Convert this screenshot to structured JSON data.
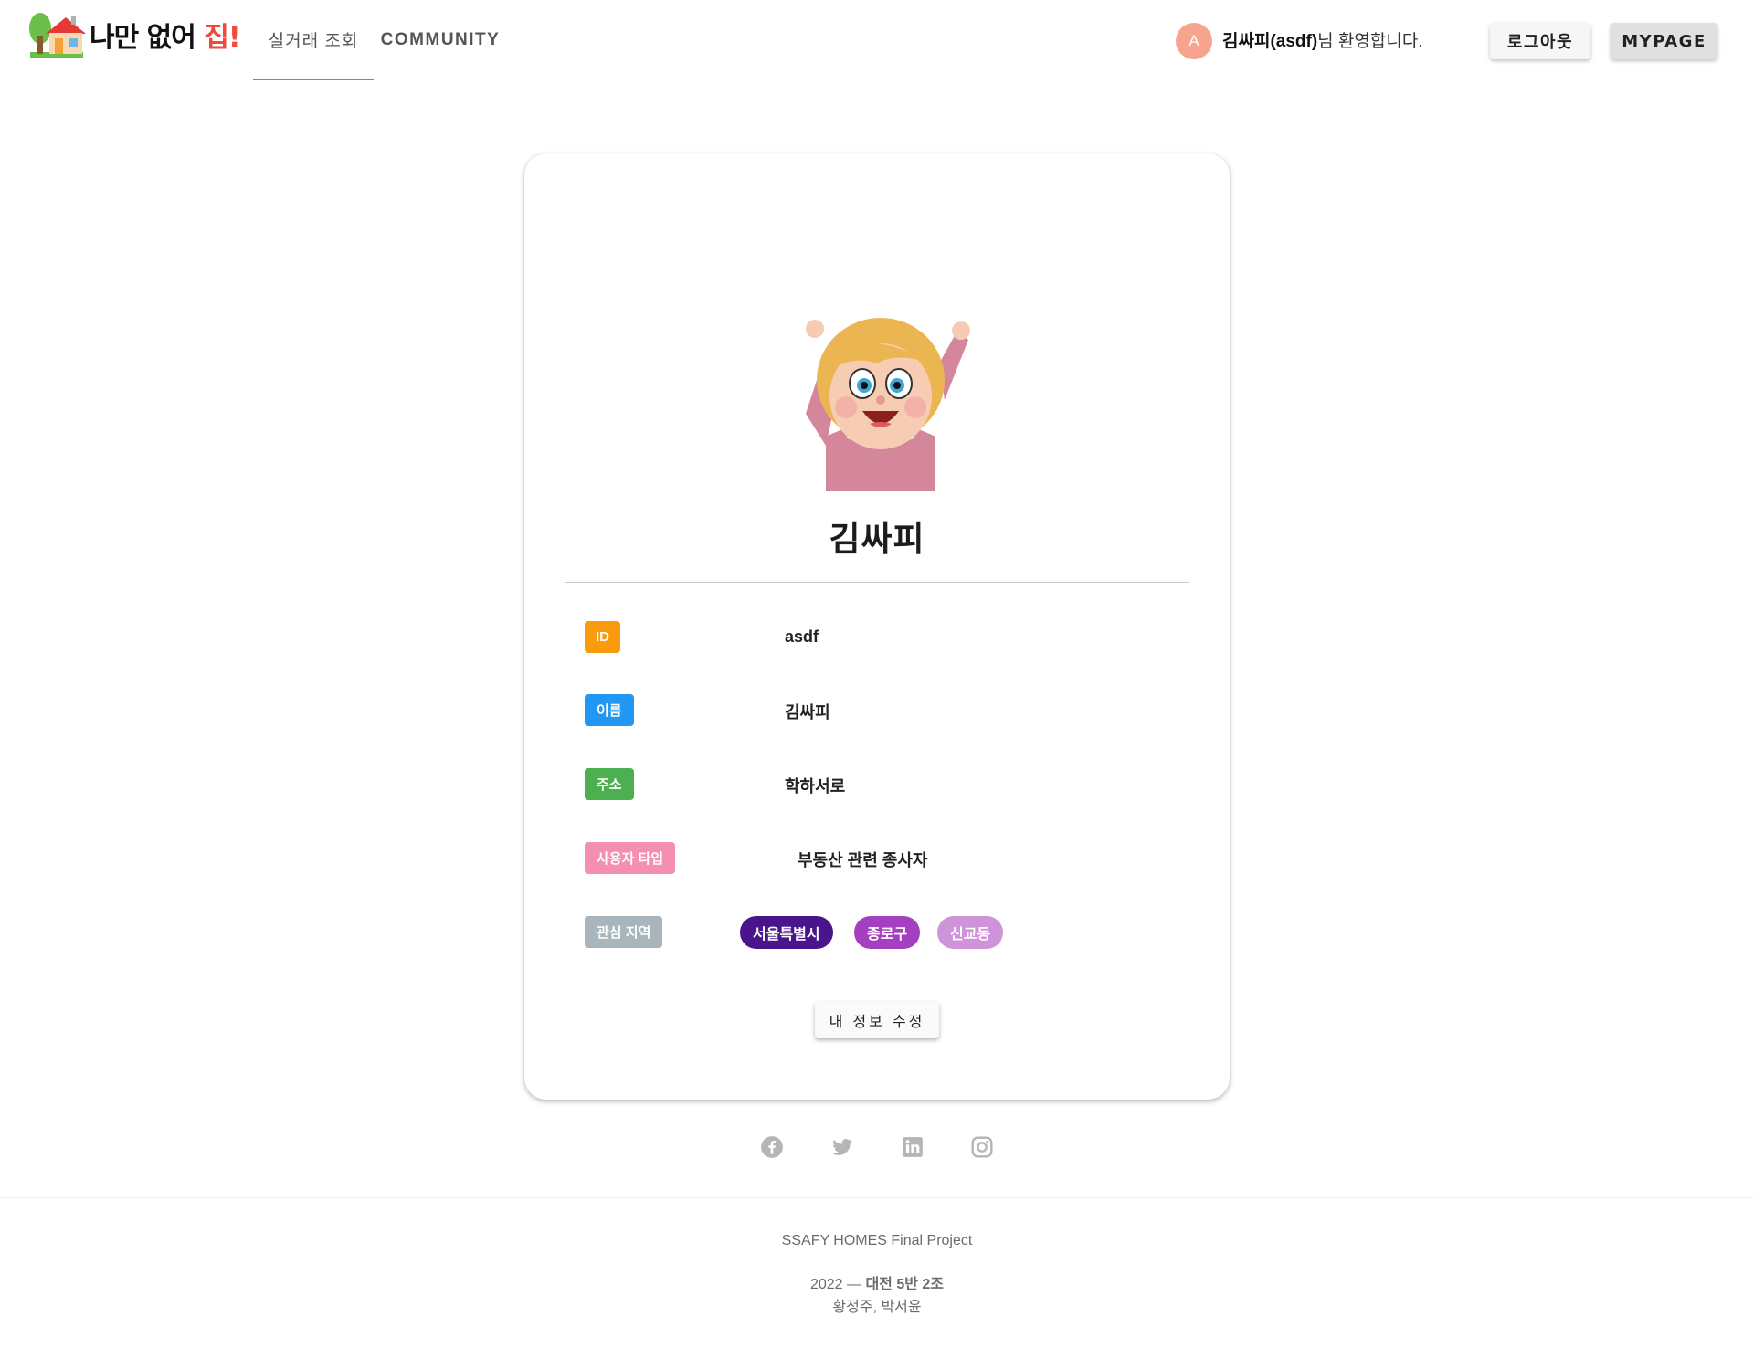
{
  "header": {
    "logo_text_main": "나만 없어 ",
    "logo_text_accent": "집!",
    "tabs": [
      {
        "label": "실거래 조회",
        "active": true
      },
      {
        "label": "COMMUNITY",
        "active": false
      }
    ],
    "avatar_initial": "A",
    "welcome_name": "김싸피(asdf)",
    "welcome_suffix": "님 환영합니다.",
    "logout_label": "로그아웃",
    "mypage_label": "MYPAGE"
  },
  "profile": {
    "name": "김싸피",
    "fields": [
      {
        "label": "ID",
        "value": "asdf",
        "color": "#f89c0e"
      },
      {
        "label": "이름",
        "value": "김싸피",
        "color": "#2196f3"
      },
      {
        "label": "주소",
        "value": "학하서로",
        "color": "#4caf50"
      },
      {
        "label": "사용자 타입",
        "value": "부동산 관련 종사자",
        "color": "#f48fb1"
      },
      {
        "label": "관심 지역",
        "value": "",
        "color": "#a8b5bd"
      }
    ],
    "interest_regions": [
      {
        "label": "서울특별시",
        "color": "#4a148c"
      },
      {
        "label": "종로구",
        "color": "#a43fbf"
      },
      {
        "label": "신교동",
        "color": "#ce93d8"
      }
    ],
    "edit_label": "내 정보 수정"
  },
  "social_icons": [
    "facebook-icon",
    "twitter-icon",
    "linkedin-icon",
    "instagram-icon"
  ],
  "footer": {
    "project": "SSAFY HOMES Final Project",
    "year_team_prefix": "2022 — ",
    "team": "대전 5반 2조",
    "members": "황정주, 박서윤"
  }
}
